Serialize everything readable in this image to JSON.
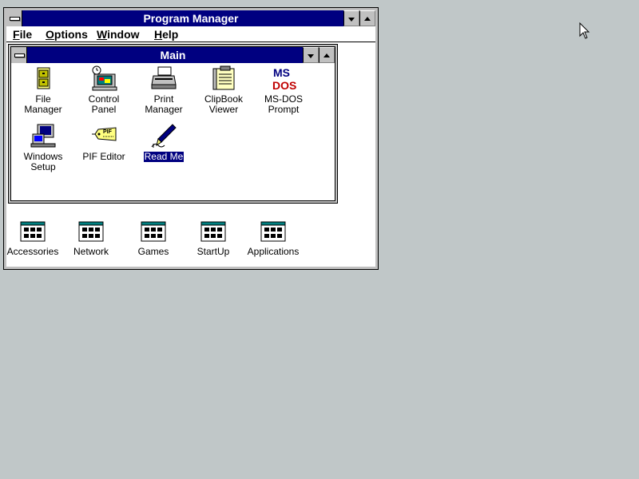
{
  "program_manager": {
    "title": "Program Manager",
    "menu": [
      {
        "label_first": "F",
        "label_rest": "ile"
      },
      {
        "label_first": "O",
        "label_rest": "ptions"
      },
      {
        "label_first": "W",
        "label_rest": "indow"
      },
      {
        "label_first": "H",
        "label_rest": "elp"
      }
    ]
  },
  "main_group": {
    "title": "Main",
    "icons": [
      {
        "label": "File Manager",
        "icon": "file-cabinet-icon"
      },
      {
        "label": "Control Panel",
        "icon": "control-panel-icon"
      },
      {
        "label": "Print Manager",
        "icon": "printer-icon"
      },
      {
        "label": "ClipBook\nViewer",
        "icon": "clipbook-icon"
      },
      {
        "label": "MS-DOS\nPrompt",
        "icon": "msdos-icon"
      },
      {
        "label": "Windows\nSetup",
        "icon": "windows-setup-icon"
      },
      {
        "label": "PIF Editor",
        "icon": "pif-tag-icon"
      },
      {
        "label": "Read Me",
        "icon": "readme-pen-icon",
        "selected": true
      }
    ]
  },
  "minimized_groups": [
    {
      "label": "Accessories"
    },
    {
      "label": "Network"
    },
    {
      "label": "Games"
    },
    {
      "label": "StartUp"
    },
    {
      "label": "Applications"
    }
  ],
  "colors": {
    "titlebar": "#000080",
    "desktop": "#c0c7c8"
  }
}
